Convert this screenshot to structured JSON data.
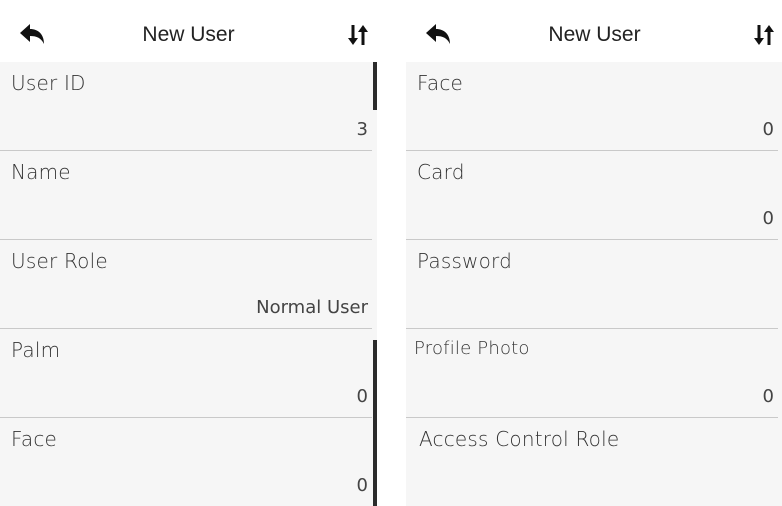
{
  "panels": [
    {
      "header": {
        "title": "New User",
        "back_icon": "back-arrow-icon",
        "sort_icon": "sort-arrows-icon"
      },
      "rows": [
        {
          "label": "User ID",
          "value": "3"
        },
        {
          "label": "Name",
          "value": ""
        },
        {
          "label": "User Role",
          "value": "Normal User"
        },
        {
          "label": "Palm",
          "value": "0"
        },
        {
          "label": "Face",
          "value": "0"
        }
      ]
    },
    {
      "header": {
        "title": "New User",
        "back_icon": "back-arrow-icon",
        "sort_icon": "sort-arrows-icon"
      },
      "rows": [
        {
          "label": "Face",
          "value": "0"
        },
        {
          "label": "Card",
          "value": "0"
        },
        {
          "label": "Password",
          "value": ""
        },
        {
          "label": "Profile Photo",
          "value": "0"
        },
        {
          "label": "Access Control Role",
          "value": ""
        }
      ]
    }
  ],
  "colors": {
    "list_background": "#f6f6f6",
    "divider": "#c9c9c9",
    "scrollbar": "#2b2b2b"
  }
}
